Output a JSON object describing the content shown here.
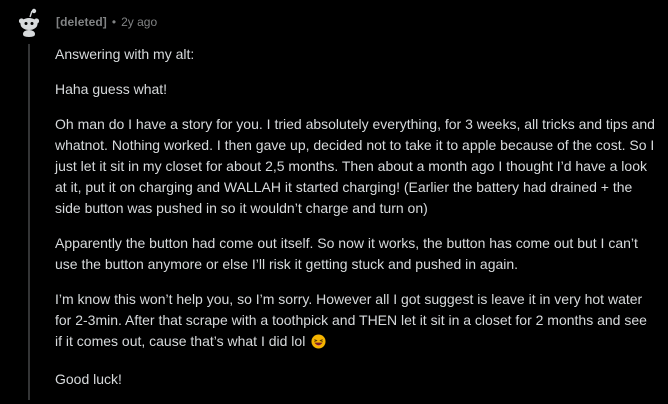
{
  "comment": {
    "author": "[deleted]",
    "separator": "•",
    "timestamp": "2y ago",
    "avatar_icon": "reddit-snoo-avatar-icon",
    "paragraphs": [
      "Answering with my alt:",
      "Haha guess what!",
      "Oh man do I have a story for you. I tried absolutely everything, for 3 weeks, all tricks and tips and whatnot. Nothing worked. I then gave up, decided not to take it to apple because of the cost. So I just let it sit in my closet for about 2,5 months. Then about a month ago I thought I’d have a look at it, put it on charging and WALLAH it started charging! (Earlier the battery had drained + the side button was pushed in so it wouldn’t charge and turn on)",
      "Apparently the button had come out itself. So now it works, the button has come out but I can’t use the button anymore or else I’ll risk it getting stuck and pushed in again.",
      "I’m know this won’t help you, so I’m sorry. However all I got suggest is leave it in very hot water for 2-3min. After that scrape with a toothpick and THEN let it sit in a closet for 2 months and see if it comes out, cause that’s what I did lol",
      "Good luck!"
    ],
    "emoji_icon": "laughing-face-emoji-icon"
  },
  "colors": {
    "background": "#000000",
    "text": "#d7dadc",
    "meta": "#818384",
    "thread_line": "#343536"
  }
}
